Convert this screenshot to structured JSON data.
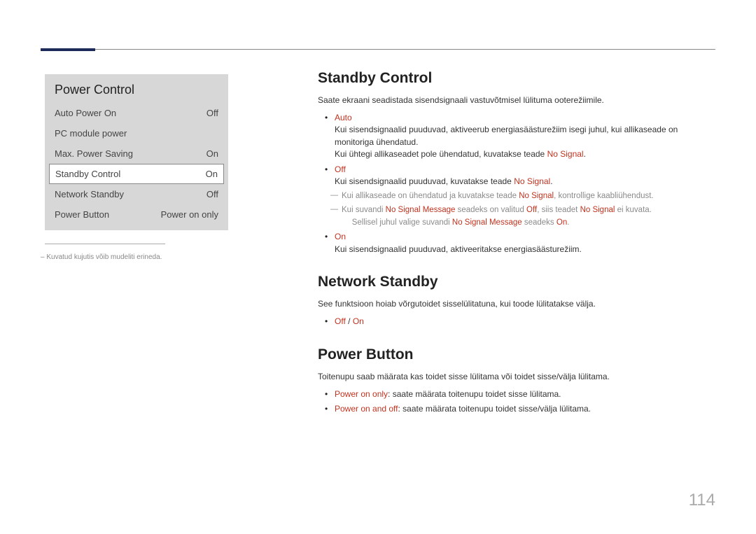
{
  "panel": {
    "title": "Power Control",
    "rows": [
      {
        "label": "Auto Power On",
        "value": "Off"
      },
      {
        "label": "PC module power",
        "value": ""
      },
      {
        "label": "Max. Power Saving",
        "value": "On"
      },
      {
        "label": "Standby Control",
        "value": "On",
        "selected": true
      },
      {
        "label": "Network Standby",
        "value": "Off"
      },
      {
        "label": "Power Button",
        "value": "Power on only"
      }
    ]
  },
  "note": "–  Kuvatud kujutis võib mudeliti erineda.",
  "sections": {
    "standby": {
      "title": "Standby Control",
      "intro": "Saate ekraani seadistada sisendsignaali vastuvõtmisel lülituma ooterežiimile.",
      "auto": {
        "label": "Auto",
        "line1": "Kui sisendsignaalid puuduvad, aktiveerub energiasäästurežiim isegi juhul, kui allikaseade on monitoriga ühendatud.",
        "line2a": "Kui ühtegi allikaseadet pole ühendatud, kuvatakse teade ",
        "line2b": "No Signal",
        "line2c": "."
      },
      "off": {
        "label": "Off",
        "line1a": "Kui sisendsignaalid puuduvad, kuvatakse teade ",
        "line1b": "No Signal",
        "line1c": ".",
        "sub1a": "Kui allikaseade on ühendatud ja kuvatakse teade ",
        "sub1b": "No Signal",
        "sub1c": ", kontrollige kaabliühendust.",
        "sub2a": "Kui suvandi ",
        "sub2b": "No Signal Message",
        "sub2c": " seadeks on valitud ",
        "sub2d": "Off",
        "sub2e": ", siis teadet ",
        "sub2f": "No Signal",
        "sub2g": " ei kuvata.",
        "sub3a": "Sellisel juhul valige suvandi ",
        "sub3b": "No Signal Message",
        "sub3c": " seadeks ",
        "sub3d": "On",
        "sub3e": "."
      },
      "on": {
        "label": "On",
        "line1": "Kui sisendsignaalid puuduvad, aktiveeritakse energiasäästurežiim."
      }
    },
    "network": {
      "title": "Network Standby",
      "intro": "See funktsioon hoiab võrgutoidet sisselülitatuna, kui toode lülitatakse välja.",
      "opt_off": "Off",
      "opt_sep": " / ",
      "opt_on": "On"
    },
    "powerbtn": {
      "title": "Power Button",
      "intro": "Toitenupu saab määrata kas toidet sisse lülitama või toidet sisse/välja lülitama.",
      "opt1_label": "Power on only",
      "opt1_text": ": saate määrata toitenupu toidet sisse lülitama.",
      "opt2_label": "Power on and off",
      "opt2_text": ": saate määrata toitenupu toidet sisse/välja lülitama."
    }
  },
  "page_number": "114"
}
